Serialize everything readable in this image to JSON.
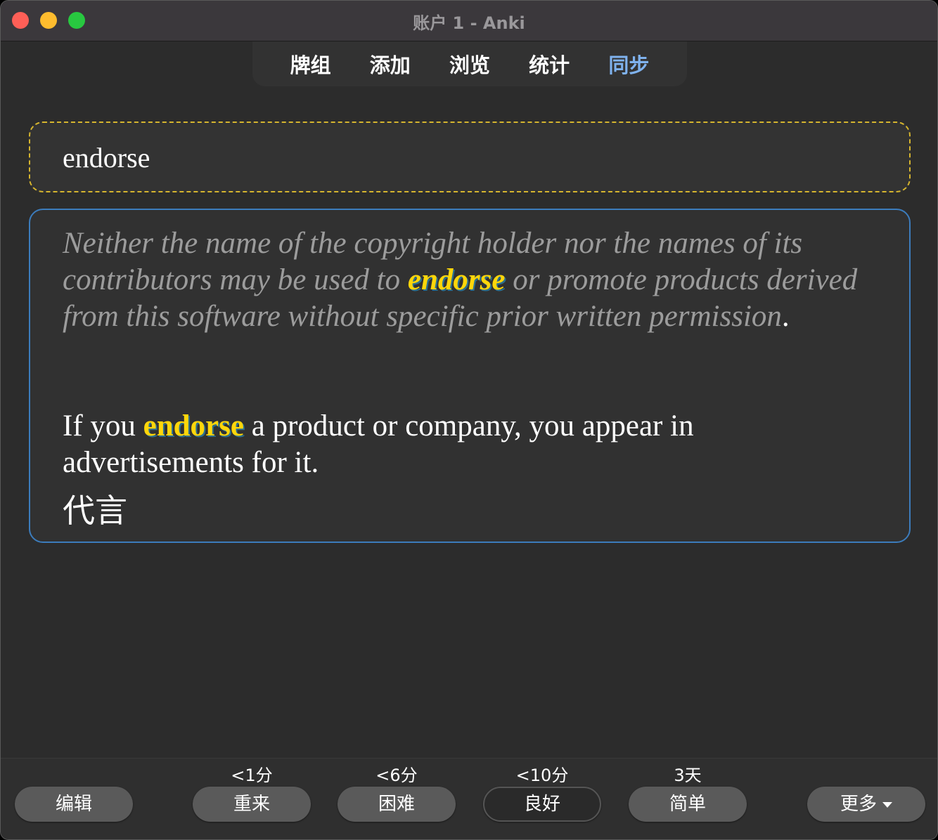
{
  "window": {
    "title": "账户 1 - Anki"
  },
  "toolbar": {
    "tabs": [
      {
        "label": "牌组"
      },
      {
        "label": "添加"
      },
      {
        "label": "浏览"
      },
      {
        "label": "统计"
      },
      {
        "label": "同步"
      }
    ],
    "active_tab": "同步",
    "active_color": "#7fb2ee"
  },
  "card": {
    "front": "endorse",
    "example": {
      "part1": "Neither the name of the copyright holder nor the names of its contributors may be used to ",
      "highlight": "endorse",
      "part2": " or promote products derived from this software without specific prior written permission",
      "end": "."
    },
    "definition": {
      "part1": "If you ",
      "highlight": "endorse",
      "part2": " a product or company, you appear in advertisements for it."
    },
    "translation": "代言",
    "highlight_color": "#ffd60a"
  },
  "bottom": {
    "edit_label": "编辑",
    "more_label": "更多",
    "answers": [
      {
        "label": "重来",
        "interval": "<1分"
      },
      {
        "label": "困难",
        "interval": "<6分"
      },
      {
        "label": "良好",
        "interval": "<10分"
      },
      {
        "label": "简单",
        "interval": "3天"
      }
    ]
  }
}
